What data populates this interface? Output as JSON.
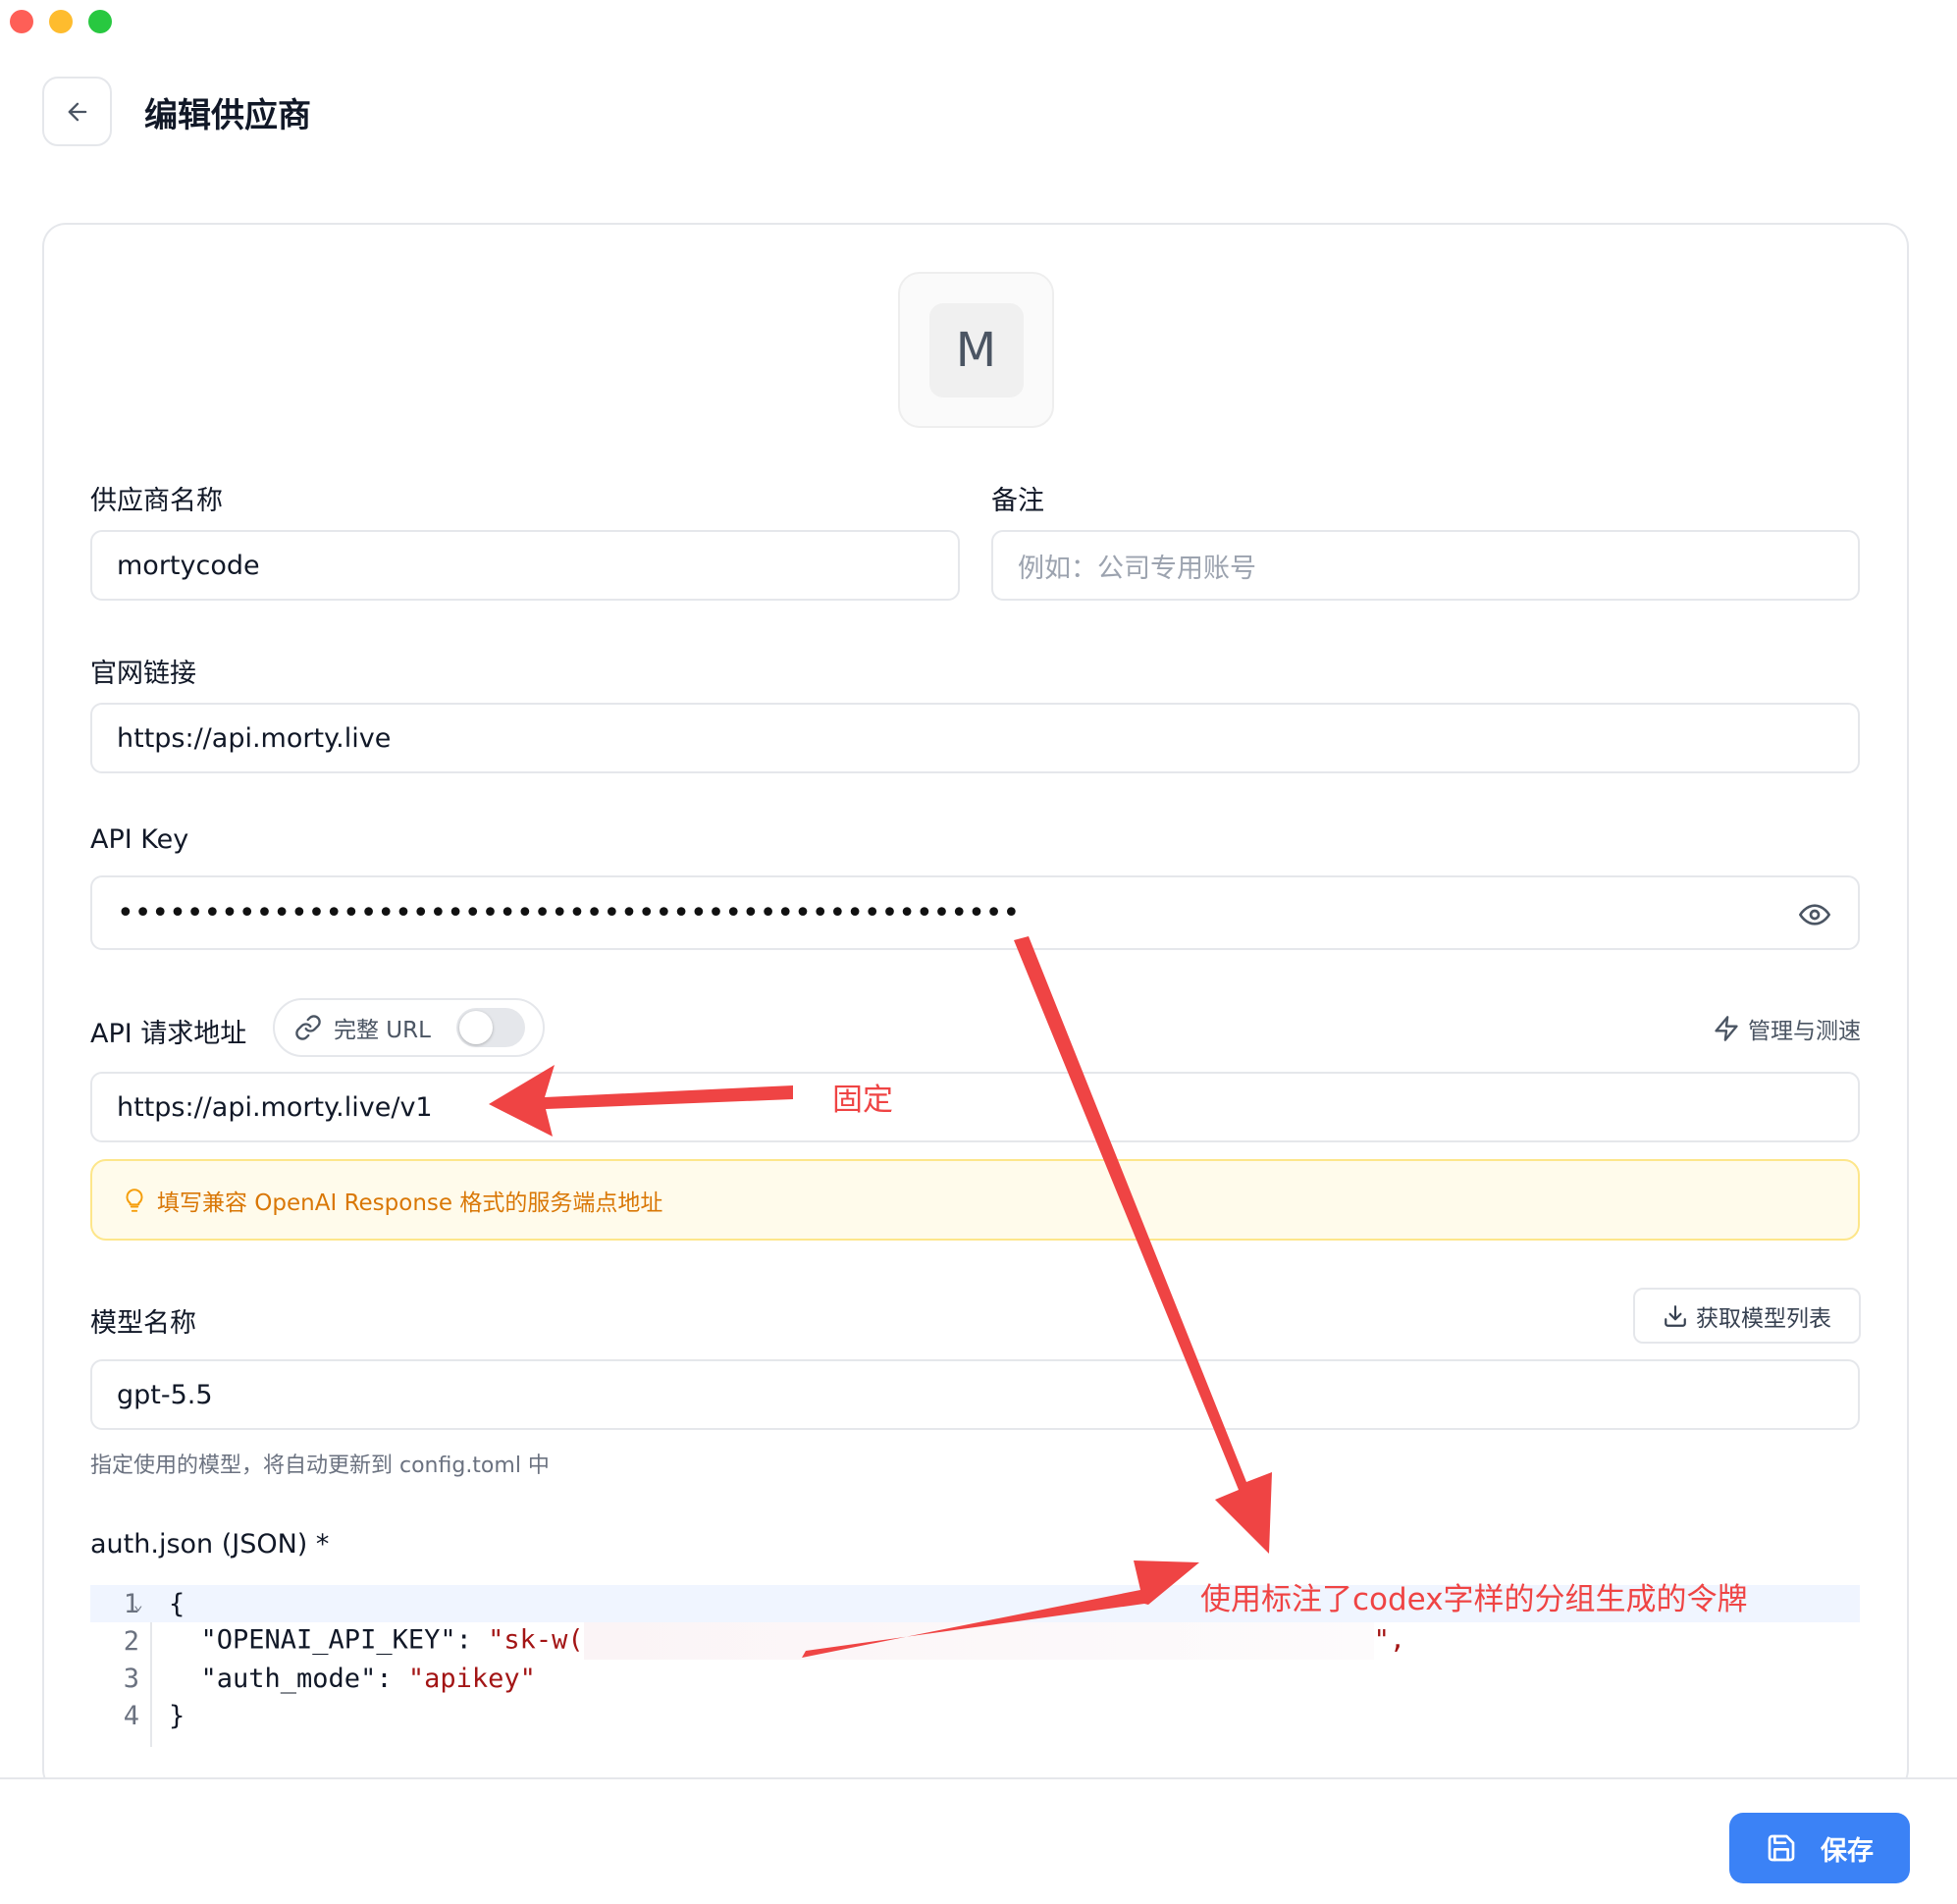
{
  "header": {
    "title": "编辑供应商"
  },
  "avatar": {
    "letter": "M"
  },
  "fields": {
    "provider_name": {
      "label": "供应商名称",
      "value": "mortycode"
    },
    "note": {
      "label": "备注",
      "placeholder": "例如：公司专用账号"
    },
    "website": {
      "label": "官网链接",
      "value": "https://api.morty.live"
    },
    "api_key": {
      "label": "API Key",
      "masked_value": "••••••••••••••••••••••••••••••••••••••••••••••••••••"
    },
    "api_url": {
      "label": "API 请求地址",
      "toggle_label": "完整 URL",
      "toggle_on": false,
      "manage_label": "管理与测速",
      "value": "https://api.morty.live/v1",
      "hint": "填写兼容 OpenAI Response 格式的服务端点地址"
    },
    "model": {
      "label": "模型名称",
      "fetch_label": "获取模型列表",
      "value": "gpt-5.5",
      "help": "指定使用的模型，将自动更新到 config.toml 中"
    },
    "auth_json": {
      "label": "auth.json (JSON) *",
      "line_numbers": [
        "1",
        "2",
        "3",
        "4"
      ],
      "line1": "{",
      "line2_key": "  \"OPENAI_API_KEY\": ",
      "line2_value_start": "\"sk-w(",
      "line2_value_end": "\",",
      "line3_key": "  \"auth_mode\": ",
      "line3_value": "\"apikey\"",
      "line4": "}"
    }
  },
  "footer": {
    "save_label": "保存"
  },
  "annotations": {
    "fixed": "固定",
    "token_note": "使用标注了codex字样的分组生成的令牌"
  },
  "colors": {
    "primary": "#3b82f6",
    "annotation": "#ef4444",
    "hint_text": "#d97706",
    "hint_bg": "#fffbeb"
  }
}
